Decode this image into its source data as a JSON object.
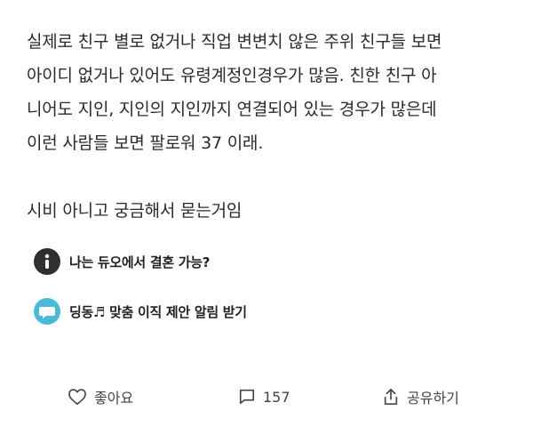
{
  "post": {
    "paragraphs": [
      [
        "실제로 친구 별로 없거나 직업 변변치 않은 주위 친구들 보면",
        "아이디 없거나 있어도 유령계정인경우가 많음. 친한 친구 아",
        "니어도 지인, 지인의 지인까지 연결되어 있는 경우가 많은데",
        "이런 사람들 보면 팔로워 37 이래."
      ],
      [
        "시비 아니고 궁금해서 묻는거임"
      ]
    ]
  },
  "links": {
    "info": {
      "icon": "info-icon",
      "label": "나는 듀오에서 결혼 가능?"
    },
    "promo": {
      "icon": "chat-bubble-icon",
      "label": "딩동♬ 맞춤 이직 제안 알림 받기"
    }
  },
  "actions": {
    "like": {
      "icon": "heart-icon",
      "label": "좋아요"
    },
    "comment": {
      "icon": "comment-icon",
      "count": "157"
    },
    "share": {
      "icon": "share-icon",
      "label": "공유하기"
    }
  },
  "colors": {
    "text": "#2b2b2b",
    "info_icon_bg": "#2f2f2f",
    "promo_icon_bg": "#4cb9d8"
  }
}
